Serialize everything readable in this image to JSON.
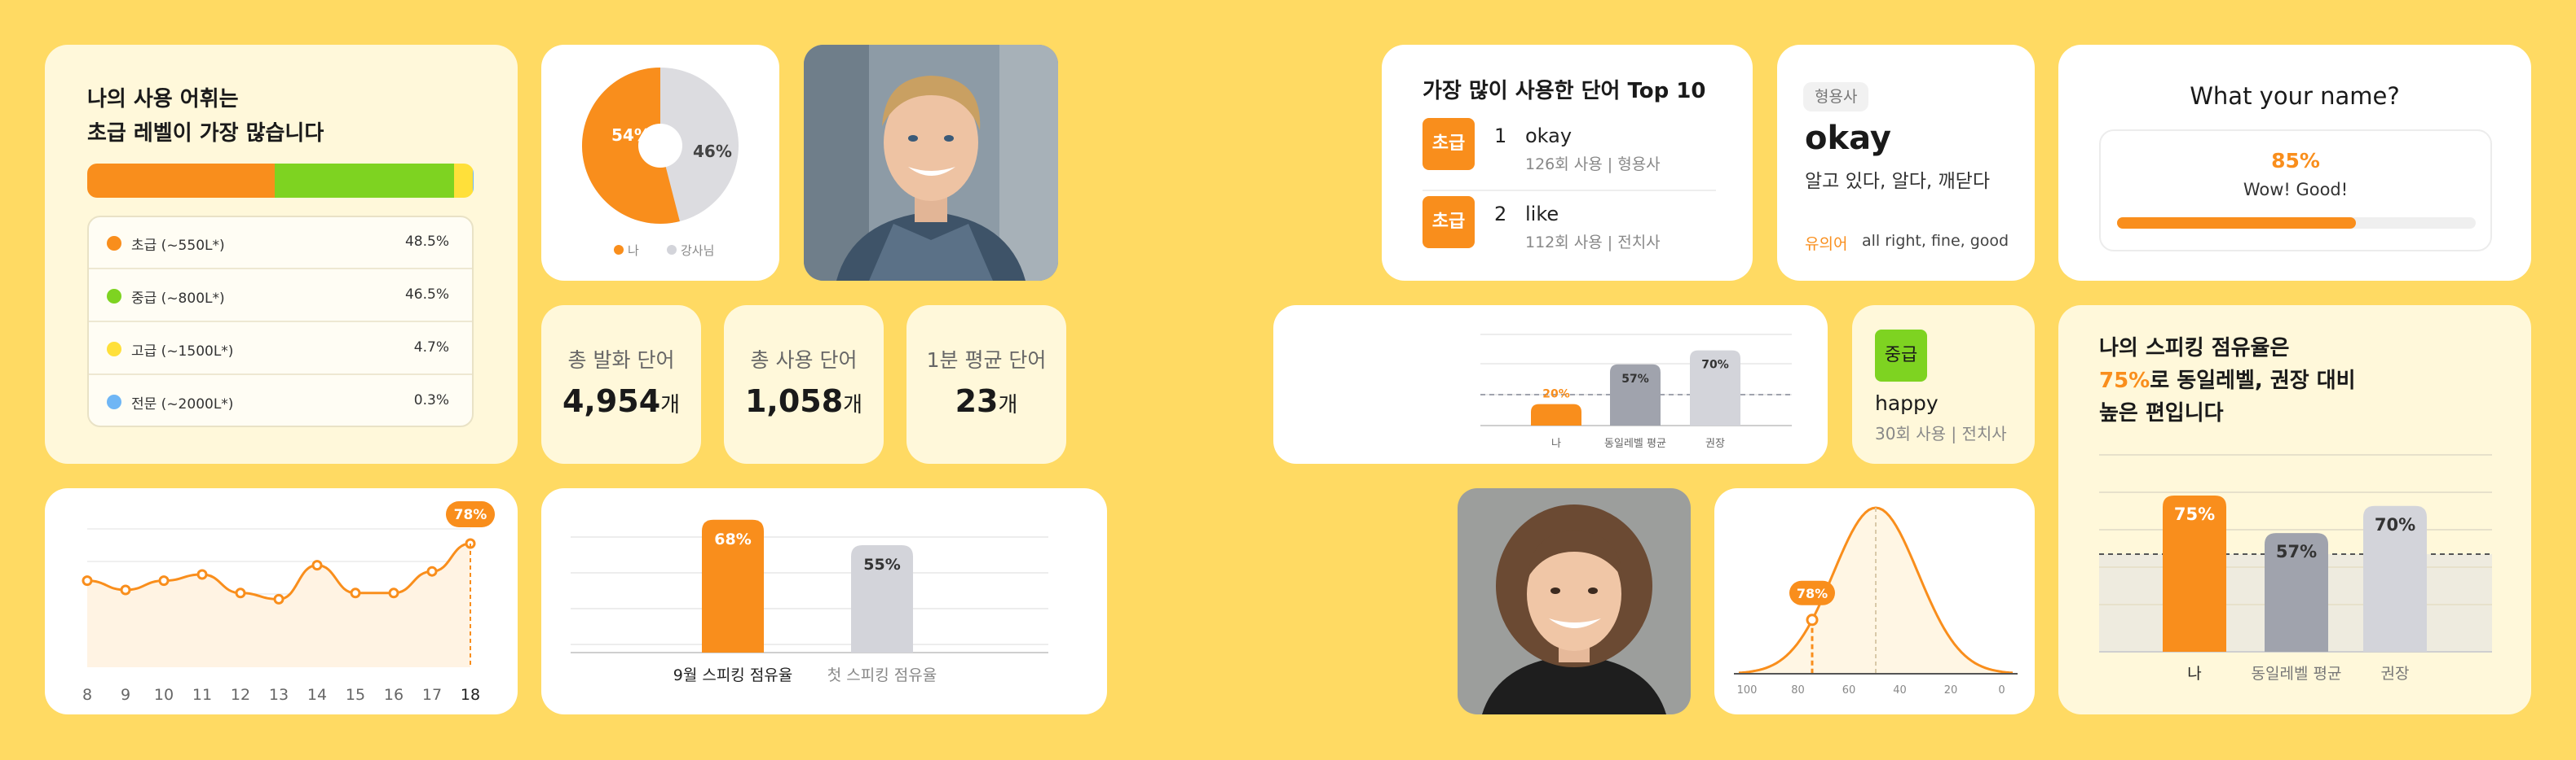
{
  "vocab_card": {
    "title_line1": "나의 사용 어휘는",
    "title_line2": "초급 레벨이 가장 많습니다",
    "levels": [
      {
        "label": "초급 (~550L*)",
        "value": "48.5%",
        "pct": 48.5,
        "color": "#F98E1C"
      },
      {
        "label": "중급 (~800L*)",
        "value": "46.5%",
        "pct": 46.5,
        "color": "#7ED321"
      },
      {
        "label": "고급 (~1500L*)",
        "value": "4.7%",
        "pct": 4.7,
        "color": "#FFE03A"
      },
      {
        "label": "전문 (~2000L*)",
        "value": "0.3%",
        "pct": 0.3,
        "color": "#6FB6F5"
      }
    ]
  },
  "donut": {
    "me_label": "54%",
    "me_value": 54,
    "tutor_label": "46%",
    "tutor_value": 46,
    "legend_me": "나",
    "legend_tutor": "강사님",
    "color_me": "#F98E1C",
    "color_tutor": "#DCDCE0"
  },
  "stats": [
    {
      "label": "총 발화 단어",
      "value": "4,954",
      "unit": "개"
    },
    {
      "label": "총 사용 단어",
      "value": "1,058",
      "unit": "개"
    },
    {
      "label": "1분 평균 단어",
      "value": "23",
      "unit": "개"
    }
  ],
  "line_chart": {
    "x": [
      "8",
      "9",
      "10",
      "11",
      "12",
      "13",
      "14",
      "15",
      "16",
      "17",
      "18"
    ],
    "values": [
      58,
      55,
      58,
      60,
      54,
      52,
      63,
      54,
      54,
      61,
      70
    ],
    "peak_label": "78%",
    "color": "#F98E1C"
  },
  "share_chart": {
    "bars": [
      {
        "label": "9월 스피킹 점유율",
        "value": 68,
        "text": "68%",
        "color": "#F98E1C"
      },
      {
        "label": "첫 스피킹 점유율",
        "value": 55,
        "text": "55%",
        "color": "#D3D4DA"
      }
    ]
  },
  "top_words": {
    "title": "가장 많이 사용한 단어 Top 10",
    "items": [
      {
        "badge": "초급",
        "rank": "1",
        "word": "okay",
        "meta": "126회 사용 | 형용사"
      },
      {
        "badge": "초급",
        "rank": "2",
        "word": "like",
        "meta": "112회 사용 | 전치사"
      }
    ]
  },
  "word_detail": {
    "pos": "형용사",
    "word": "okay",
    "meaning": "알고 있다, 알다, 깨닫다",
    "synonym_label": "유의어",
    "synonyms": "all right, fine, good"
  },
  "name_card": {
    "title": "What your name?",
    "score": "85%",
    "score_value": 85,
    "comment": "Wow! Good!"
  },
  "mini_bars": {
    "bars": [
      {
        "label": "나",
        "value": 20,
        "text": "20%",
        "color": "#F98E1C"
      },
      {
        "label": "동일레벨 평균",
        "value": 57,
        "text": "57%",
        "color": "#A0A3AD"
      },
      {
        "label": "권장",
        "value": 70,
        "text": "70%",
        "color": "#D3D4DA"
      }
    ]
  },
  "mid_word": {
    "badge": "중급",
    "word": "happy",
    "meta": "30회 사용 | 전치사"
  },
  "bell_curve": {
    "x_ticks": [
      "100",
      "80",
      "60",
      "40",
      "20",
      "0"
    ],
    "marker_label": "78%"
  },
  "speaking_card": {
    "line1": "나의 스피킹 점유율은",
    "line2_highlight": "75%",
    "line2_rest": "로 동일레벨, 권장 대비",
    "line3": "높은 편입니다",
    "bars": [
      {
        "label": "나",
        "value": 75,
        "text": "75%",
        "color": "#F98E1C"
      },
      {
        "label": "동일레벨 평균",
        "value": 57,
        "text": "57%",
        "color": "#A0A3AD"
      },
      {
        "label": "권장",
        "value": 70,
        "text": "70%",
        "color": "#D3D4DA"
      }
    ]
  },
  "colors": {
    "background": "#FFDA63",
    "accent": "#F98E1C",
    "green": "#7ED321",
    "cream": "#FFF8DA"
  }
}
